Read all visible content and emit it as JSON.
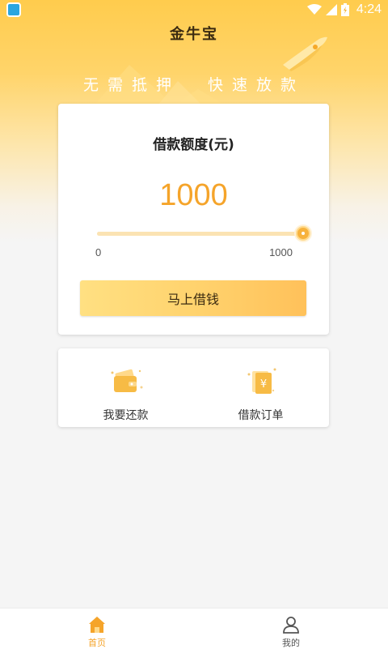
{
  "status_bar": {
    "time": "4:24"
  },
  "header": {
    "title": "金牛宝",
    "slogan": "无需抵押  快速放款"
  },
  "loan": {
    "title": "借款额度(元)",
    "amount": "1000",
    "slider_min": "0",
    "slider_max": "1000",
    "slider_fraction": 1.0,
    "button_label": "马上借钱"
  },
  "actions": [
    {
      "label": "我要还款",
      "icon": "wallet-icon"
    },
    {
      "label": "借款订单",
      "icon": "yuan-document-icon"
    }
  ],
  "bottom_nav": [
    {
      "label": "首页",
      "icon": "home-icon",
      "active": true
    },
    {
      "label": "我的",
      "icon": "user-icon",
      "active": false
    }
  ],
  "colors": {
    "accent": "#f5a42a",
    "active_nav": "#f5a42a",
    "inactive_nav": "#555555"
  }
}
